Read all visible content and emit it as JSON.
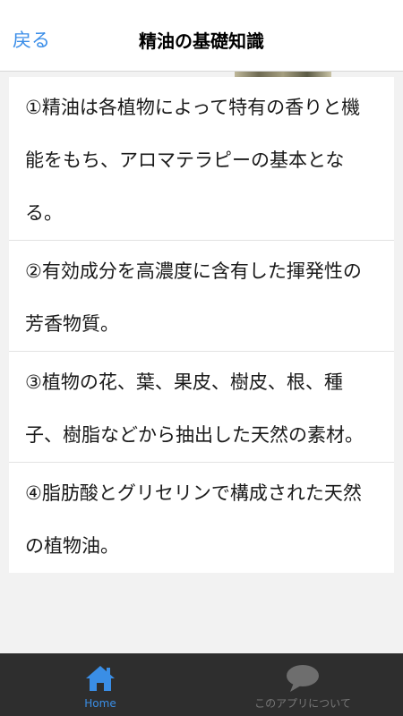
{
  "navbar": {
    "back_label": "戻る",
    "title": "精油の基礎知識"
  },
  "items": [
    {
      "text": "①精油は各植物によって特有の香りと機能をもち、アロマテラピーの基本となる。"
    },
    {
      "text": "②有効成分を高濃度に含有した揮発性の芳香物質。"
    },
    {
      "text": "③植物の花、葉、果皮、樹皮、根、種子、樹脂などから抽出した天然の素材。"
    },
    {
      "text": "④脂肪酸とグリセリンで構成された天然の植物油。"
    }
  ],
  "tabbar": {
    "tabs": [
      {
        "label": "Home",
        "icon": "home-icon",
        "active": true,
        "color": "#3a8ee6"
      },
      {
        "label": "このアプリについて",
        "icon": "speech-bubble-icon",
        "active": false,
        "color": "#777777"
      }
    ]
  },
  "colors": {
    "accent": "#3b8ee8",
    "tabbar_bg": "#2e2e2e",
    "content_bg": "#f2f2f2"
  }
}
